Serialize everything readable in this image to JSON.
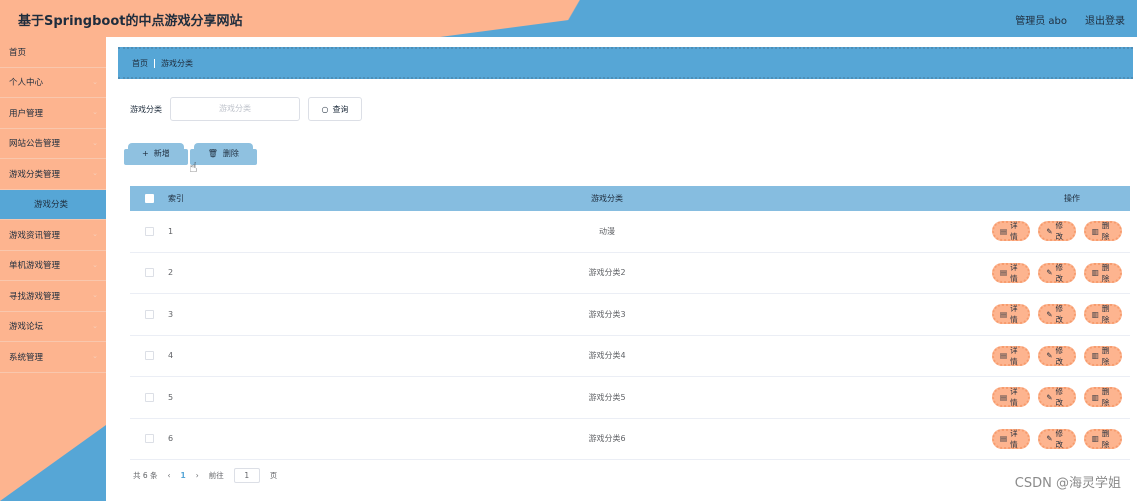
{
  "header": {
    "title": "基于Springboot的中点游戏分享网站",
    "user_label": "管理员 abo",
    "logout_label": "退出登录"
  },
  "sidebar": {
    "items": [
      {
        "label": "首页",
        "has_arrow": false
      },
      {
        "label": "个人中心",
        "has_arrow": true
      },
      {
        "label": "用户管理",
        "has_arrow": true
      },
      {
        "label": "网站公告管理",
        "has_arrow": true
      },
      {
        "label": "游戏分类管理",
        "has_arrow": true
      },
      {
        "label": "游戏分类",
        "has_arrow": false,
        "sub": true
      },
      {
        "label": "游戏资讯管理",
        "has_arrow": true
      },
      {
        "label": "单机游戏管理",
        "has_arrow": true
      },
      {
        "label": "寻找游戏管理",
        "has_arrow": true
      },
      {
        "label": "游戏论坛",
        "has_arrow": true
      },
      {
        "label": "系统管理",
        "has_arrow": true
      }
    ]
  },
  "breadcrumb": {
    "home": "首页",
    "current": "游戏分类"
  },
  "search": {
    "label": "游戏分类",
    "placeholder": "游戏分类",
    "button": "查询"
  },
  "actions": {
    "add": "新增",
    "delete": "删除"
  },
  "table": {
    "headers": {
      "index": "索引",
      "category": "游戏分类",
      "ops": "操作"
    },
    "ops": {
      "detail": "详情",
      "edit": "修改",
      "delete": "删除"
    },
    "rows": [
      {
        "index": "1",
        "category": "动漫"
      },
      {
        "index": "2",
        "category": "游戏分类2"
      },
      {
        "index": "3",
        "category": "游戏分类3"
      },
      {
        "index": "4",
        "category": "游戏分类4"
      },
      {
        "index": "5",
        "category": "游戏分类5"
      },
      {
        "index": "6",
        "category": "游戏分类6"
      }
    ]
  },
  "pagination": {
    "total": "共 6 条",
    "current": "1",
    "goto_label": "前往",
    "goto_value": "1",
    "page_suffix": "页"
  },
  "watermark": "CSDN @海灵学姐",
  "colors": {
    "peach": "#fdb48f",
    "blue": "#56a6d6"
  }
}
